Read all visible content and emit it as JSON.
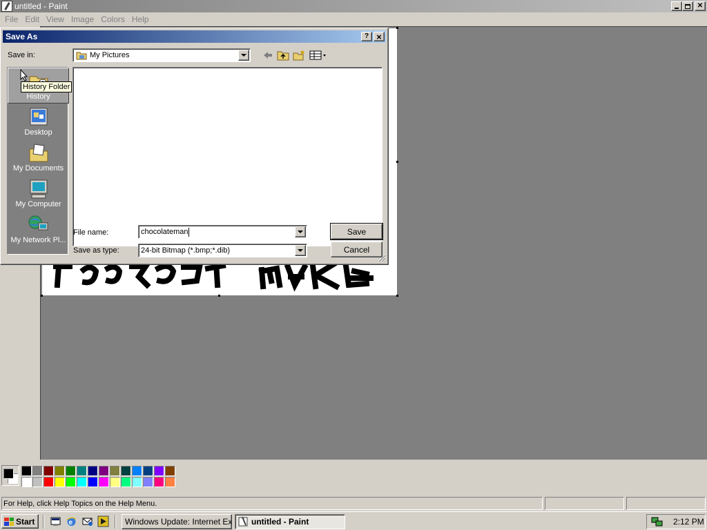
{
  "paint_window": {
    "title": "untitled - Paint",
    "menu": [
      "File",
      "Edit",
      "View",
      "Image",
      "Colors",
      "Help"
    ],
    "palette_colors": [
      [
        "#000000",
        "#808080",
        "#800000",
        "#808000",
        "#008000",
        "#008080",
        "#000080",
        "#800080",
        "#808040",
        "#004040",
        "#0080ff",
        "#004080",
        "#8000ff",
        "#804000"
      ],
      [
        "#ffffff",
        "#c0c0c0",
        "#ff0000",
        "#ffff00",
        "#00ff00",
        "#00ffff",
        "#0000ff",
        "#ff00ff",
        "#ffff80",
        "#00ff80",
        "#80ffff",
        "#8080ff",
        "#ff0080",
        "#ff8040"
      ]
    ],
    "foreground_color": "#000000",
    "background_color": "#ffffff",
    "status_text": "For Help, click Help Topics on the Help Menu."
  },
  "dialog": {
    "title": "Save As",
    "help_button": "?",
    "close_button": "×",
    "save_in_label": "Save in:",
    "save_in_value": "My Pictures",
    "places": [
      {
        "label": "History",
        "icon": "history-folder-icon"
      },
      {
        "label": "Desktop",
        "icon": "desktop-icon"
      },
      {
        "label": "My Documents",
        "icon": "my-documents-icon"
      },
      {
        "label": "My Computer",
        "icon": "my-computer-icon"
      },
      {
        "label": "My Network Pl...",
        "icon": "network-places-icon"
      }
    ],
    "file_name_label": "File name:",
    "file_name_value": "chocolateman",
    "save_as_type_label": "Save as type:",
    "save_as_type_value": "24-bit Bitmap (*.bmp;*.dib)",
    "save_button": "Save",
    "cancel_button": "Cancel",
    "tooltip": "History Folder"
  },
  "taskbar": {
    "start_label": "Start",
    "tasks": [
      {
        "label": "Windows Update: Internet Exp...",
        "active": false
      },
      {
        "label": "untitled - Paint",
        "active": true
      }
    ],
    "clock": "2:12 PM"
  }
}
